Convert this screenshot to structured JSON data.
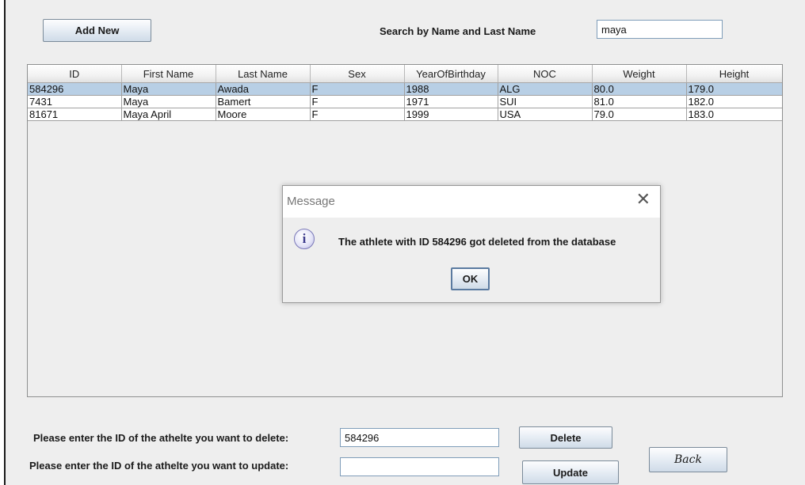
{
  "toolbar": {
    "add_new_label": "Add New",
    "search_label": "Search by Name and Last Name",
    "search_value": "maya"
  },
  "table": {
    "columns": [
      "ID",
      "First Name",
      "Last Name",
      "Sex",
      "YearOfBirthday",
      "NOC",
      "Weight",
      "Height"
    ],
    "rows": [
      [
        "584296",
        "Maya",
        "Awada",
        "F",
        "1988",
        "ALG",
        "80.0",
        "179.0"
      ],
      [
        "7431",
        "Maya",
        "Bamert",
        "F",
        "1971",
        "SUI",
        "81.0",
        "182.0"
      ],
      [
        "81671",
        "Maya April",
        "Moore",
        "F",
        "1999",
        "USA",
        "79.0",
        "183.0"
      ]
    ],
    "selected_row": 0
  },
  "dialog": {
    "title": "Message",
    "close_glyph": "✕",
    "icon": "info-icon",
    "icon_glyph": "i",
    "message": "The athlete with ID 584296 got deleted from the database",
    "ok_label": "OK"
  },
  "bottom": {
    "delete_prompt": "Please enter the ID of the athelte you want to delete:",
    "delete_value": "584296",
    "delete_label": "Delete",
    "update_prompt": "Please enter the ID of the athelte you want to update:",
    "update_value": "",
    "update_label": "Update",
    "back_label": "Back"
  },
  "colors": {
    "selection": "#b8cfe5",
    "panel": "#eeeeee",
    "icon_accent": "#3c3a8c"
  }
}
